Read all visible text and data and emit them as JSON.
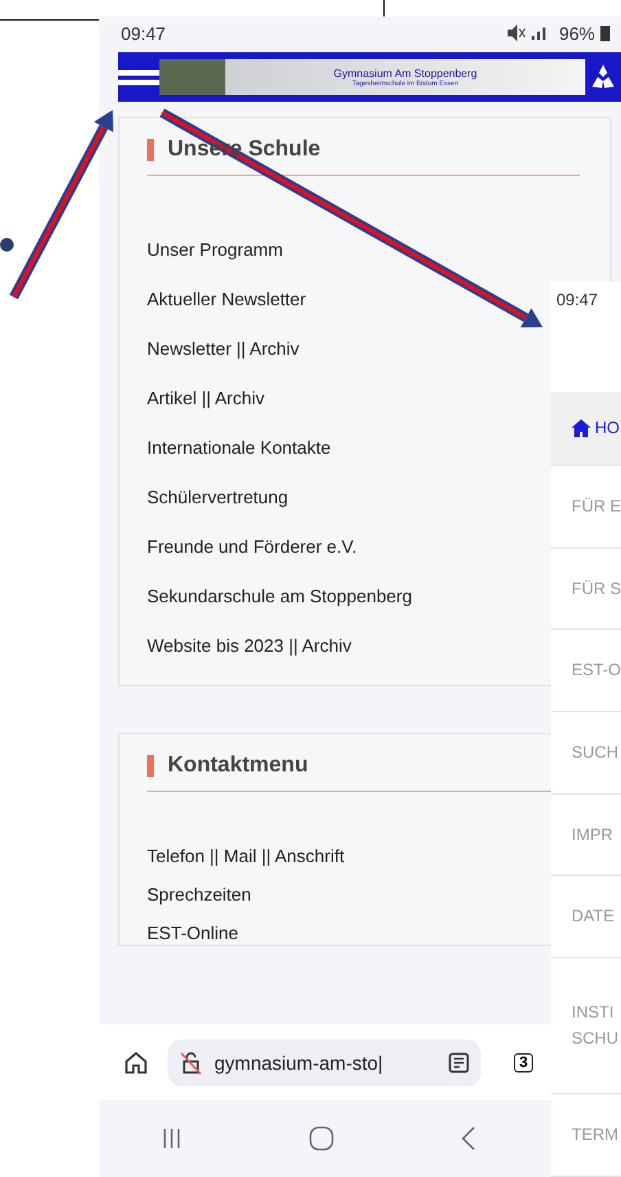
{
  "left_phone": {
    "status_bar": {
      "time": "09:47",
      "battery": "96%"
    },
    "banner": {
      "title": "Gymnasium Am Stoppenberg",
      "subtitle": "Tagesheimschule im Bistum Essen"
    },
    "sections": [
      {
        "title": "Unsere Schule",
        "items": [
          "Unser Programm",
          "Aktueller Newsletter",
          "Newsletter || Archiv",
          "Artikel || Archiv",
          "Internationale Kontakte",
          "Schülervertretung",
          "Freunde und Förderer e.V.",
          "Sekundarschule am Stoppenberg",
          "Website bis 2023 || Archiv"
        ]
      },
      {
        "title": "Kontaktmenu",
        "items": [
          "Telefon || Mail || Anschrift",
          "Sprechzeiten",
          "EST-Online"
        ]
      }
    ],
    "browser_bar": {
      "url": "gymnasium-am-sto|",
      "tab_count": "3"
    }
  },
  "right_phone": {
    "status_bar": {
      "time": "09:47"
    },
    "menu": [
      {
        "label": "HO",
        "kind": "home",
        "selected": true
      },
      {
        "label": "FÜR E",
        "kind": "text",
        "selected": false
      },
      {
        "label": "FÜR S",
        "kind": "text",
        "selected": false
      },
      {
        "label": "EST-O",
        "kind": "text",
        "selected": false
      },
      {
        "label": "SUCH",
        "kind": "text",
        "selected": false
      },
      {
        "label": "IMPR",
        "kind": "text",
        "selected": false
      },
      {
        "label": "DATE",
        "kind": "text",
        "selected": false
      },
      {
        "label": "INSTI\nSCHU",
        "kind": "text",
        "selected": false
      },
      {
        "label": "TERM",
        "kind": "text",
        "selected": false
      }
    ]
  }
}
